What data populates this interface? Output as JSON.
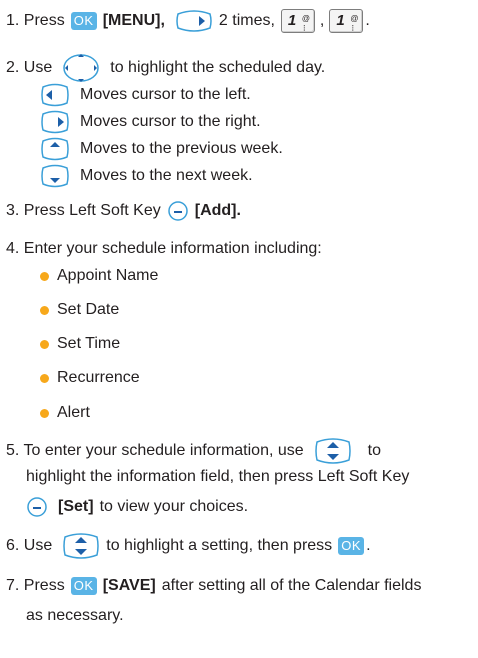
{
  "steps": {
    "s1": {
      "num": "1. Press",
      "menu": "[MENU],",
      "times": "2 times,",
      "comma": ",",
      "period": ".",
      "key1": "1",
      "key1_sup": "@\n:+"
    },
    "s2": {
      "num": "2. Use",
      "text": "to highlight the scheduled day.",
      "sub": [
        "Moves cursor to the left.",
        "Moves cursor to the right.",
        "Moves to the previous week.",
        "Moves to the next week."
      ]
    },
    "s3": {
      "num": "3. Press Left Soft Key",
      "add": "[Add]."
    },
    "s4": {
      "num": "4. Enter your schedule information including:",
      "bullets": [
        "Appoint Name",
        "Set Date",
        "Set Time",
        "Recurrence",
        "Alert"
      ]
    },
    "s5": {
      "num": "5. To enter your schedule information, use",
      "to": "to",
      "line2": "highlight the information field, then press Left Soft Key",
      "set": "[Set]",
      "line3": "to view your choices."
    },
    "s6": {
      "num": "6. Use",
      "text": "to highlight a setting, then press",
      "period": "."
    },
    "s7": {
      "num": "7. Press",
      "save": "[SAVE]",
      "text": "after setting all of the Calendar fields",
      "line2": "as necessary."
    }
  },
  "ok_label": "OK",
  "colors": {
    "ok_button": "#5ab4e6",
    "bullet": "#f7a81b",
    "key_icon_outline": "#3a9fd8"
  }
}
